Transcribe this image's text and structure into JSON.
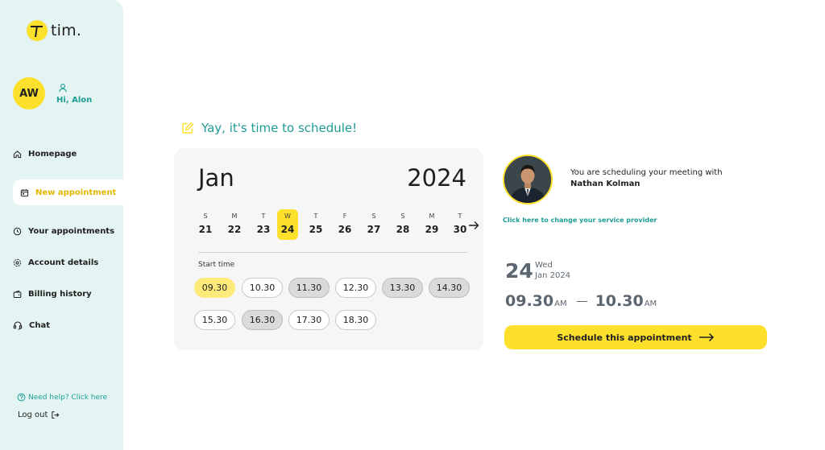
{
  "brand": {
    "name": "tim."
  },
  "user": {
    "initials": "AW",
    "greeting": "Hi, Alon"
  },
  "nav": {
    "items": [
      {
        "label": "Homepage",
        "icon": "home-icon"
      },
      {
        "label": "New appointment",
        "icon": "calendar-icon",
        "active": true
      },
      {
        "label": "Your appointments",
        "icon": "clock-icon"
      },
      {
        "label": "Account details",
        "icon": "gear-icon"
      },
      {
        "label": "Billing history",
        "icon": "wallet-icon"
      },
      {
        "label": "Chat",
        "icon": "headset-icon"
      }
    ],
    "help": "Need help? Click here",
    "logout": "Log out"
  },
  "heading": "Yay, it's time to schedule!",
  "calendar": {
    "month": "Jan",
    "year": "2024",
    "days": [
      {
        "letter": "S",
        "num": "21"
      },
      {
        "letter": "M",
        "num": "22"
      },
      {
        "letter": "T",
        "num": "23"
      },
      {
        "letter": "W",
        "num": "24",
        "selected": true
      },
      {
        "letter": "T",
        "num": "25"
      },
      {
        "letter": "F",
        "num": "26"
      },
      {
        "letter": "S",
        "num": "27"
      },
      {
        "letter": "S",
        "num": "28"
      },
      {
        "letter": "M",
        "num": "29"
      },
      {
        "letter": "T",
        "num": "30"
      }
    ],
    "start_time_label": "Start time",
    "slots": [
      {
        "time": "09.30",
        "state": "selected"
      },
      {
        "time": "10.30",
        "state": "available"
      },
      {
        "time": "11.30",
        "state": "taken"
      },
      {
        "time": "12.30",
        "state": "available"
      },
      {
        "time": "13.30",
        "state": "taken"
      },
      {
        "time": "14.30",
        "state": "taken"
      },
      {
        "time": "15.30",
        "state": "available"
      },
      {
        "time": "16.30",
        "state": "taken"
      },
      {
        "time": "17.30",
        "state": "available"
      },
      {
        "time": "18.30",
        "state": "available"
      }
    ]
  },
  "provider": {
    "intro": "You are scheduling your meeting with",
    "name": "Nathan Kolman",
    "change_link": "Click here to change your service provider"
  },
  "summary": {
    "day": "24",
    "weekday": "Wed",
    "month_year": "Jan 2024",
    "start": "09.30",
    "start_ampm": "AM",
    "end": "10.30",
    "end_ampm": "AM"
  },
  "cta": {
    "label": "Schedule this appointment"
  },
  "colors": {
    "accent": "#fde02c",
    "teal": "#1e9d95",
    "sidebar": "#e4f4f2"
  }
}
